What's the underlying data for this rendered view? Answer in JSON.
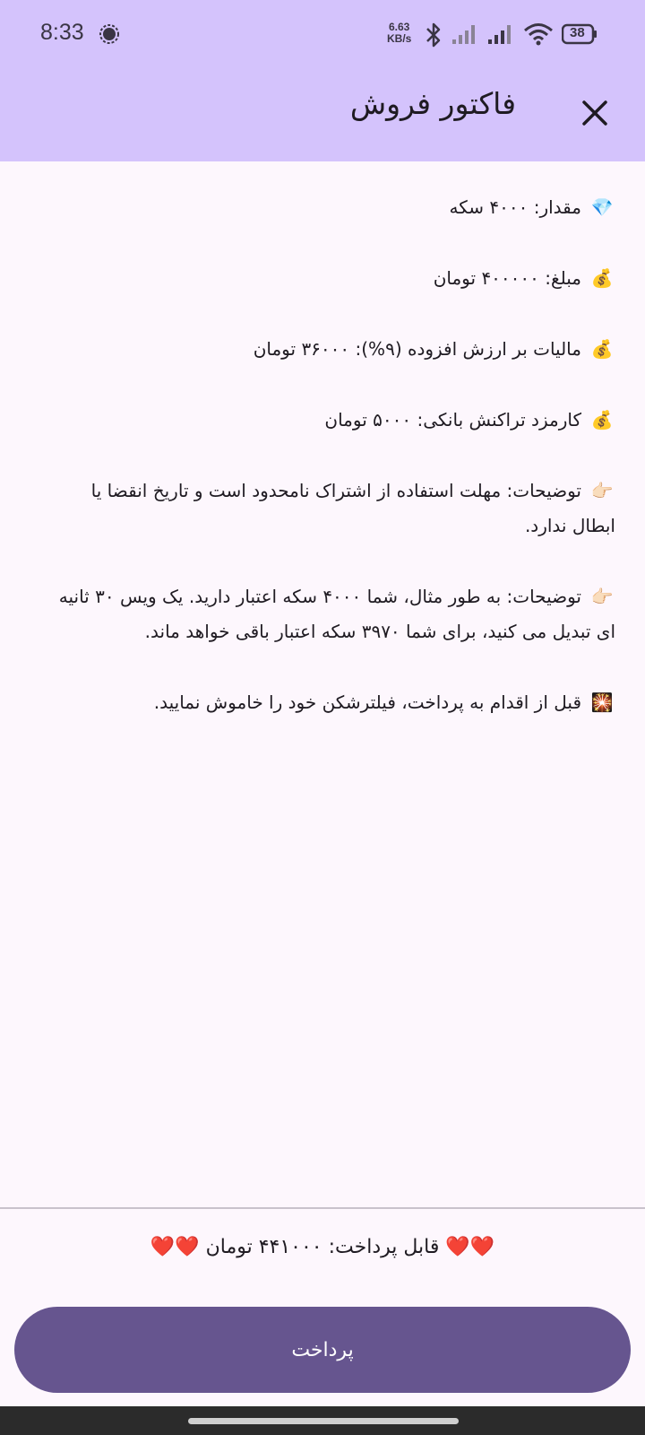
{
  "status_bar": {
    "time": "8:33",
    "net_speed_value": "6.63",
    "net_speed_unit": "KB/s",
    "battery": "38"
  },
  "header": {
    "title": "فاکتور فروش",
    "close_icon": "close-icon"
  },
  "invoice": {
    "amount_line": "مقدار: ۴۰۰۰ سکه",
    "price_line": "مبلغ: ۴۰۰۰۰۰ تومان",
    "tax_line": "مالیات بر ارزش افزوده (۹%): ۳۶۰۰۰ تومان",
    "fee_line": "کارمزد تراکنش بانکی: ۵۰۰۰ تومان",
    "note1": "توضیحات: مهلت استفاده از اشتراک نامحدود است و تاریخ انقضا یا ابطال ندارد.",
    "note2": "توضیحات: به طور مثال، شما ۴۰۰۰ سکه اعتبار دارید. یک ویس ۳۰ ثانیه ای تبدیل می کنید، برای شما ۳۹۷۰ سکه اعتبار باقی خواهد ماند.",
    "warning": "قبل از اقدام به پرداخت، فیلترشکن خود را خاموش نمایید.",
    "icons": {
      "amount": "💎",
      "money": "💰",
      "pointer": "👉🏻",
      "firework": "🎇"
    }
  },
  "footer": {
    "payable_text": "قابل پرداخت: ۴۴۱۰۰۰ تومان",
    "hearts": "❤️❤️",
    "pay_button": "پرداخت"
  },
  "colors": {
    "app_bar": "#d4c3fc",
    "background": "#fdf7fd",
    "button": "#66558f"
  }
}
